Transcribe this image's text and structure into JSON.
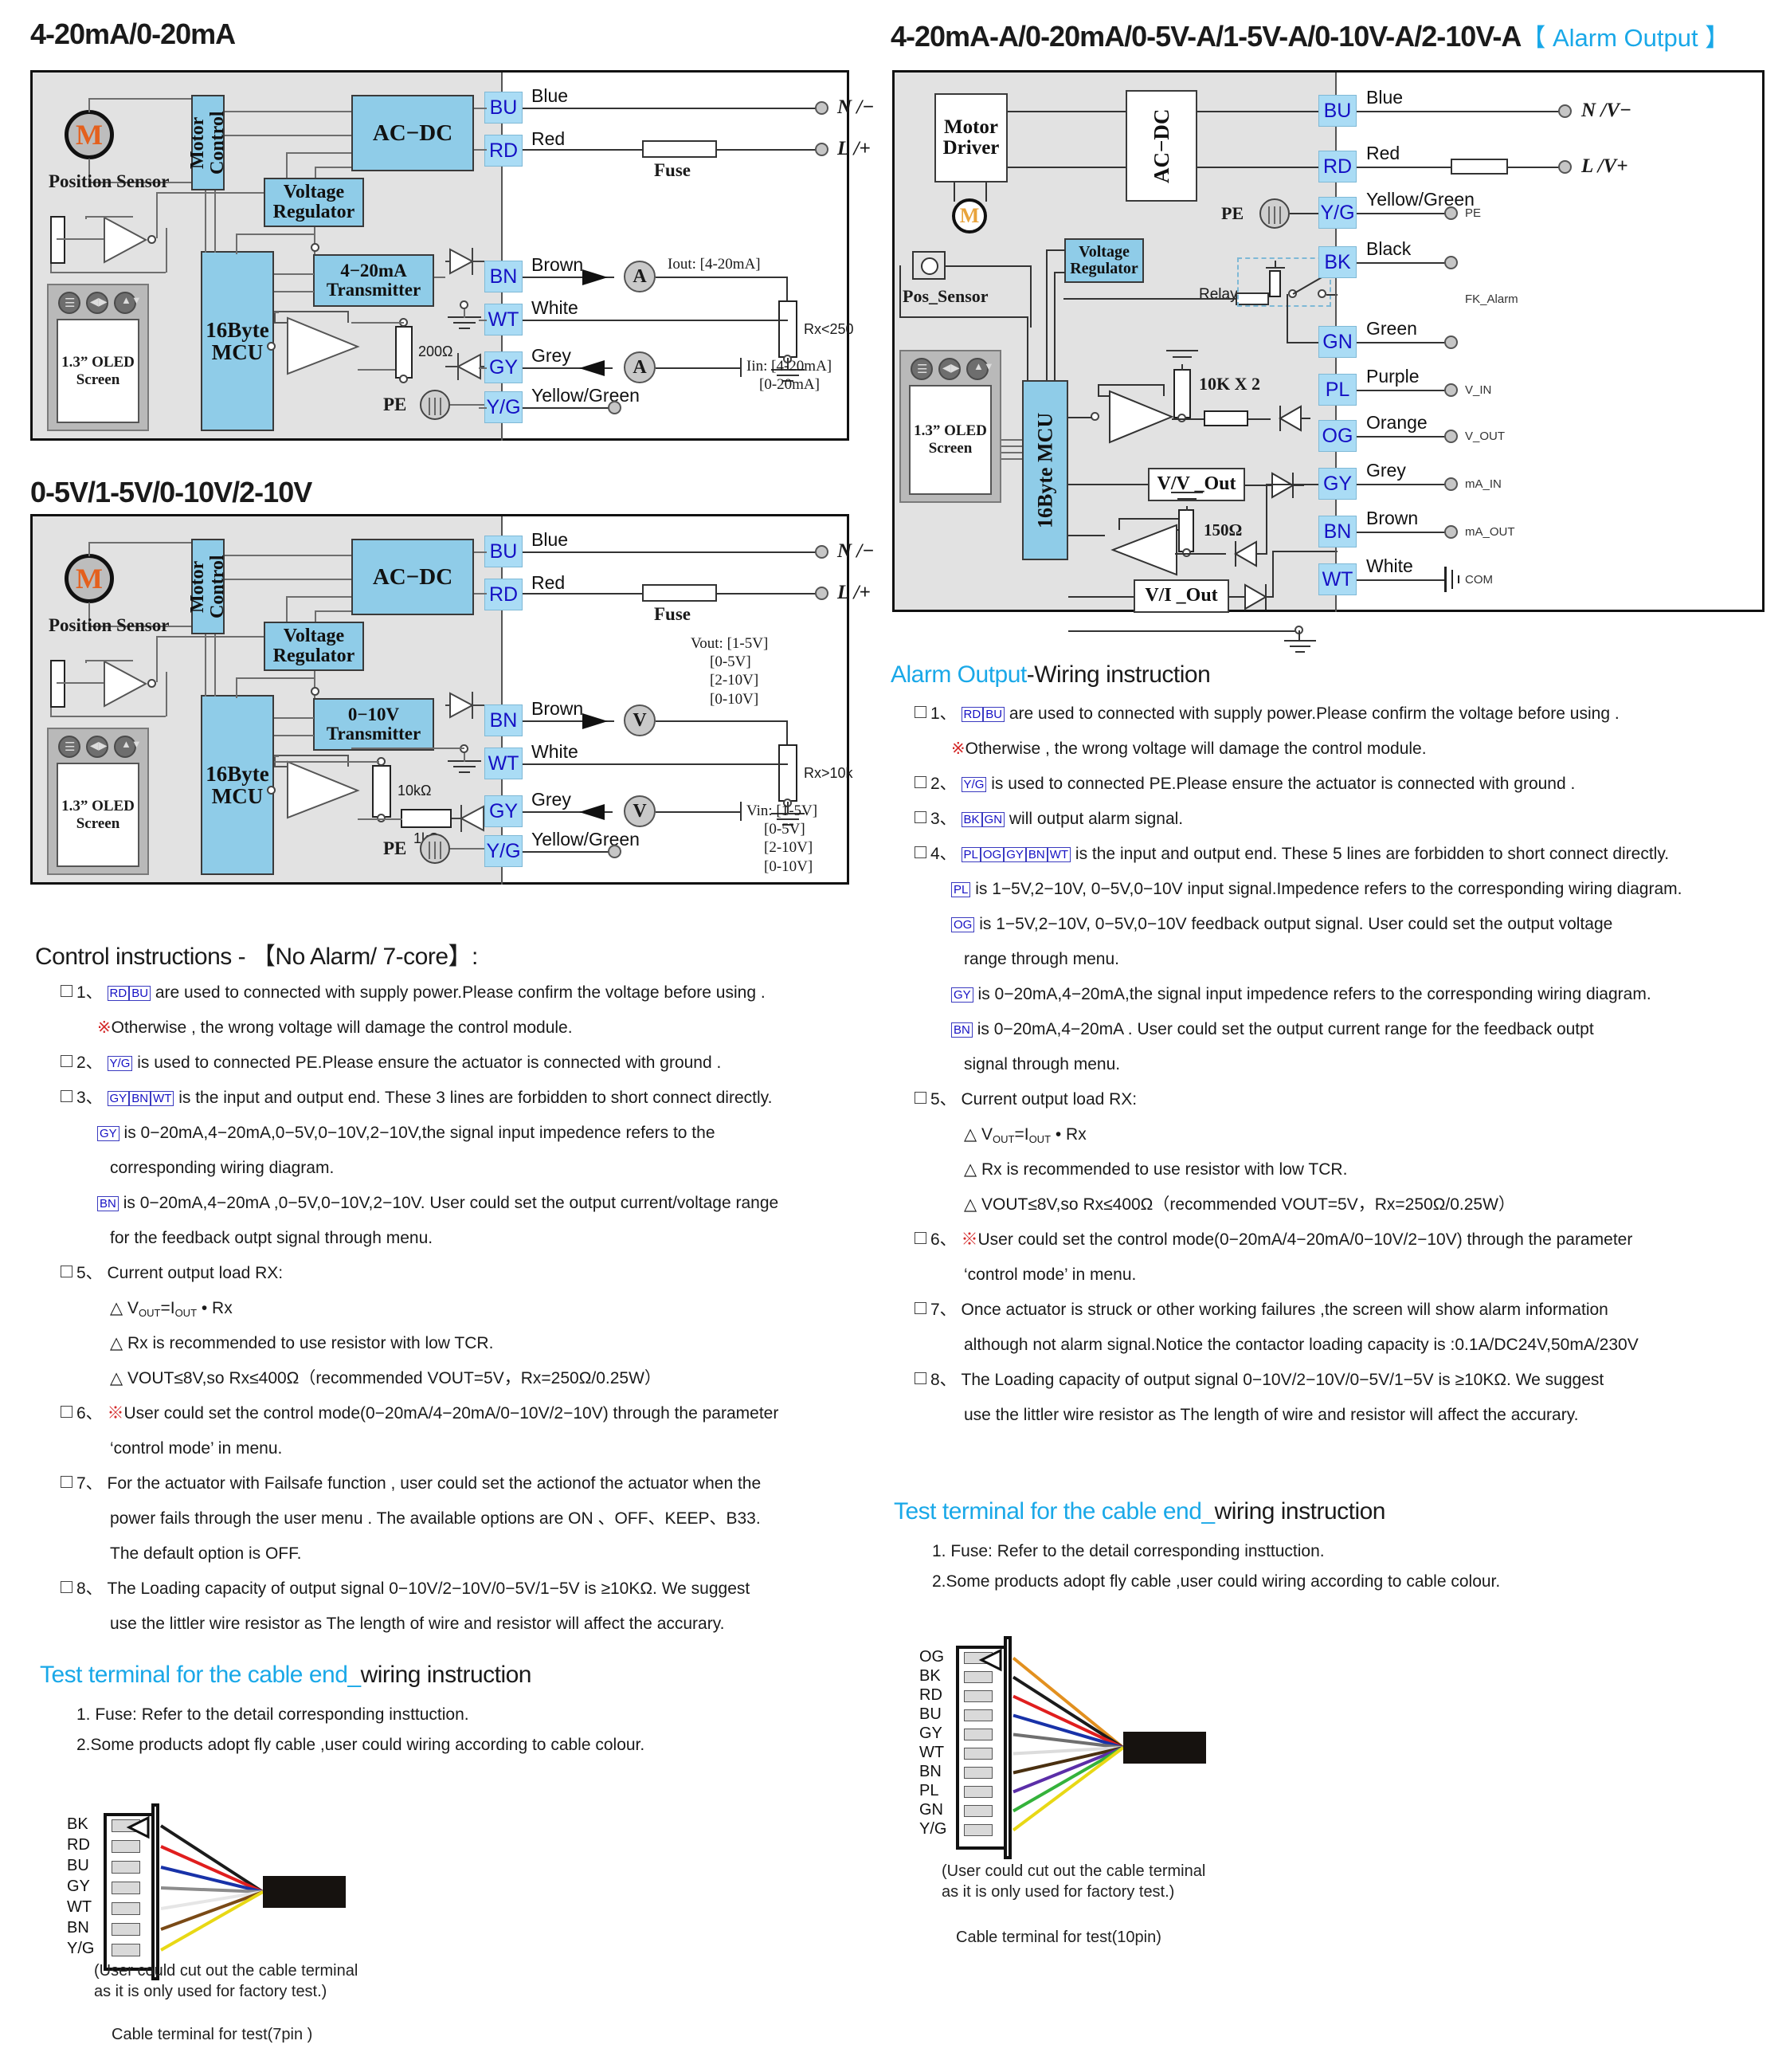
{
  "sections": {
    "diagram1_title": "4-20mA/0-20mA",
    "diagram2_title": "0-5V/1-5V/0-10V/2-10V",
    "diagram3_title": "4-20mA-A/0-20mA/0-5V-A/1-5V-A/0-10V-A/2-10V-A",
    "diagram3_tag": "【 Alarm Output 】",
    "control_head": "Control instructions - 【No Alarm/ 7-core】:",
    "alarm_head_blue": "Alarm Output",
    "alarm_head_rest": "-Wiring instruction",
    "test_head_blue": "Test terminal for the cable end_",
    "test_head_rest": "wiring instruction"
  },
  "blocks": {
    "motor_control": "Motor Control",
    "motor_driver": "Motor Driver",
    "ac_dc": "AC−DC",
    "voltage_regulator": "Voltage Regulator",
    "transmitter_ma": "4−20mA Transmitter",
    "transmitter_v": "0−10V Transmitter",
    "mcu": "16Byte MCU",
    "oled": "1.3” OLED Screen",
    "position_sensor": "Position Sensor",
    "pos_sensor_short": "Pos_Sensor",
    "motor_letter": "M",
    "pe": "PE",
    "relay": "Relay",
    "vv_out": "V/V _Out",
    "vi_out": "V/I _Out",
    "fuse": "Fuse"
  },
  "resistors": {
    "r200": "200Ω",
    "r10k": "10kΩ",
    "r1k": "1kΩ",
    "r150": "150Ω",
    "r10kx2": "10K X 2",
    "rx_lt250": "Rx<250",
    "rx_gt10k": "Rx>10k"
  },
  "diagram1": {
    "terminals": [
      {
        "code": "BU",
        "colour": "Blue",
        "end": "N /−"
      },
      {
        "code": "RD",
        "colour": "Red",
        "end": "L /+"
      },
      {
        "code": "BN",
        "colour": "Brown",
        "end": ""
      },
      {
        "code": "WT",
        "colour": "White",
        "end": ""
      },
      {
        "code": "GY",
        "colour": "Grey",
        "end": ""
      },
      {
        "code": "Y/G",
        "colour": "Yellow/Green",
        "end": ""
      }
    ],
    "meter_out_glyph": "A",
    "meter_in_glyph": "A",
    "iout_label": "Iout: [4-20mA]",
    "iin_label_1": "Iin: [4-20mA]",
    "iin_label_2": "[0-20mA]"
  },
  "diagram2": {
    "terminals": [
      {
        "code": "BU",
        "colour": "Blue",
        "end": "N /−"
      },
      {
        "code": "RD",
        "colour": "Red",
        "end": "L /+"
      },
      {
        "code": "BN",
        "colour": "Brown",
        "end": ""
      },
      {
        "code": "WT",
        "colour": "White",
        "end": ""
      },
      {
        "code": "GY",
        "colour": "Grey",
        "end": ""
      },
      {
        "code": "Y/G",
        "colour": "Yellow/Green",
        "end": ""
      }
    ],
    "meter_out_glyph": "V",
    "meter_in_glyph": "V",
    "vout_lines": [
      "Vout: [1-5V]",
      "[0-5V]",
      "[2-10V]",
      "[0-10V]"
    ],
    "vin_lines": [
      "Vin: [1-5V]",
      "[0-5V]",
      "[2-10V]",
      "[0-10V]"
    ]
  },
  "diagram3": {
    "terminals": [
      {
        "code": "BU",
        "colour": "Blue",
        "end": "N /V−",
        "fn": ""
      },
      {
        "code": "RD",
        "colour": "Red",
        "end": "L /V+",
        "fn": ""
      },
      {
        "code": "Y/G",
        "colour": "Yellow/Green",
        "end": "",
        "fn": "PE"
      },
      {
        "code": "BK",
        "colour": "Black",
        "end": "",
        "fn": ""
      },
      {
        "code": "GN",
        "colour": "Green",
        "end": "",
        "fn": ""
      },
      {
        "code": "PL",
        "colour": "Purple",
        "end": "",
        "fn": "V_IN"
      },
      {
        "code": "OG",
        "colour": "Orange",
        "end": "",
        "fn": "V_OUT"
      },
      {
        "code": "GY",
        "colour": "Grey",
        "end": "",
        "fn": "mA_IN"
      },
      {
        "code": "BN",
        "colour": "Brown",
        "end": "",
        "fn": "mA_OUT"
      },
      {
        "code": "WT",
        "colour": "White",
        "end": "",
        "fn": "COM"
      }
    ],
    "fk_alarm": "FK_Alarm"
  },
  "control_items": [
    {
      "n": "1、",
      "tags": [
        "RD",
        "BU"
      ],
      "text": "are used to connected with  supply power.Please confirm the voltage before using ."
    },
    {
      "n": "",
      "note": "※Otherwise , the wrong voltage will damage the control module."
    },
    {
      "n": "2、",
      "tags": [
        "Y/G"
      ],
      "text": "is used to connected PE.Please  ensure the actuator is connected with ground ."
    },
    {
      "n": "3、",
      "tags": [
        "GY",
        "BN",
        "WT"
      ],
      "text": "is the input and output end. These 3 lines are forbidden to short connect directly."
    },
    {
      "n": "",
      "tags": [
        "GY"
      ],
      "text": "is 0−20mA,4−20mA,0−5V,0−10V,2−10V,the signal input impedence refers to the"
    },
    {
      "n": "",
      "cont": "corresponding wiring diagram."
    },
    {
      "n": "",
      "tags": [
        "BN"
      ],
      "text": "is 0−20mA,4−20mA ,0−5V,0−10V,2−10V. User could set the output current/voltage range"
    },
    {
      "n": "",
      "cont": "for the feedback outpt signal through menu."
    },
    {
      "n": "5、",
      "text": "Current output  load RX:"
    },
    {
      "n": "",
      "cont": "△ VOUT=IOUT • Rx"
    },
    {
      "n": "",
      "cont": "△ Rx is recommended to use resistor with low TCR."
    },
    {
      "n": "",
      "cont": "△ VOUT≤8V,so Rx≤400Ω（recommended VOUT=5V，Rx=250Ω/0.25W）"
    },
    {
      "n": "6、",
      "text": "※User could set the control mode(0−20mA/4−20mA/0−10V/2−10V)  through the  parameter"
    },
    {
      "n": "",
      "cont": "‘control mode’ in menu."
    },
    {
      "n": "7、",
      "text": "For the actuator with Failsafe function , user could set the actionof the actuator when the"
    },
    {
      "n": "",
      "cont": "power fails through the  user menu . The available options are  ON 、OFF、KEEP、B33."
    },
    {
      "n": "",
      "cont": "The default option is OFF."
    },
    {
      "n": "8、",
      "text": "The Loading capacity  of output signal  0−10V/2−10V/0−5V/1−5V is  ≥10KΩ. We suggest"
    },
    {
      "n": "",
      "cont": "use the littler wire resistor as The length of wire and resistor will affect the accurary."
    }
  ],
  "alarm_items": [
    {
      "n": "1、",
      "tags": [
        "RD",
        "BU"
      ],
      "text": "are used to connected with  supply power.Please confirm the voltage before using ."
    },
    {
      "n": "",
      "note": "※Otherwise , the wrong voltage will damage the control module."
    },
    {
      "n": "2、",
      "tags": [
        "Y/G"
      ],
      "text": "is used to connected PE.Please  ensure the actuator is connected with ground ."
    },
    {
      "n": "3、",
      "tags": [
        "BK",
        "GN"
      ],
      "text": "will output alarm signal."
    },
    {
      "n": "4、",
      "tags": [
        "PL",
        "OG",
        "GY",
        "BN",
        "WT"
      ],
      "text": "is the input and output end. These 5 lines are forbidden to short connect directly."
    },
    {
      "n": "",
      "tags": [
        "PL"
      ],
      "text": "is 1−5V,2−10V, 0−5V,0−10V input signal.Impedence refers to the corresponding wiring diagram."
    },
    {
      "n": "",
      "tags": [
        "OG"
      ],
      "text": "is 1−5V,2−10V, 0−5V,0−10V feedback output signal. User could set the output voltage"
    },
    {
      "n": "",
      "cont": "range through menu."
    },
    {
      "n": "",
      "tags": [
        "GY"
      ],
      "text": "is 0−20mA,4−20mA,the signal input impedence refers to the corresponding wiring diagram."
    },
    {
      "n": "",
      "tags": [
        "BN"
      ],
      "text": "is 0−20mA,4−20mA . User could set the output current range for the feedback outpt"
    },
    {
      "n": "",
      "cont": "signal through menu."
    },
    {
      "n": "5、",
      "text": "Current output  load RX:"
    },
    {
      "n": "",
      "cont": "△ VOUT=IOUT • Rx"
    },
    {
      "n": "",
      "cont": "△ Rx is recommended to use resistor with low TCR."
    },
    {
      "n": "",
      "cont": "△ VOUT≤8V,so Rx≤400Ω（recommended VOUT=5V，Rx=250Ω/0.25W）"
    },
    {
      "n": "6、",
      "text": "※User could set the control mode(0−20mA/4−20mA/0−10V/2−10V)  through the  parameter"
    },
    {
      "n": "",
      "cont": "‘control mode’ in menu."
    },
    {
      "n": "7、",
      "text": "Once actuator is struck or other working failures ,the screen will show alarm information"
    },
    {
      "n": "",
      "cont": "although not alarm signal.Notice the contactor loading capacity is :0.1A/DC24V,50mA/230V"
    },
    {
      "n": "8、",
      "text": "The Loading capacity  of output signal  0−10V/2−10V/0−5V/1−5V is  ≥10KΩ. We suggest"
    },
    {
      "n": "",
      "cont": "use the littler wire resistor as The length of wire and resistor will affect the accurary."
    }
  ],
  "test_terminal": {
    "line1": "1. Fuse: Refer to the detail corresponding insttuction.",
    "line2": "2.Some products adopt fly cable ,user could wiring according to cable colour.",
    "note_l1": "(User could cut out the cable terminal",
    "note_l2": "as it is only used for factory test.)",
    "caption_7pin": "Cable terminal for test(7pin )",
    "caption_10pin": "Cable terminal for test(10pin)",
    "pins_7": [
      {
        "code": "BK",
        "colour": "#1b1b1b"
      },
      {
        "code": "RD",
        "colour": "#e01e1e"
      },
      {
        "code": "BU",
        "colour": "#1832a8"
      },
      {
        "code": "GY",
        "colour": "#8c8c8c"
      },
      {
        "code": "WT",
        "colour": "#e6e6e6"
      },
      {
        "code": "BN",
        "colour": "#7a4a16"
      },
      {
        "code": "Y/G",
        "colour": "#e8d815"
      }
    ],
    "pins_10": [
      {
        "code": "OG",
        "colour": "#e2901f"
      },
      {
        "code": "BK",
        "colour": "#1b1b1b"
      },
      {
        "code": "RD",
        "colour": "#e01e1e"
      },
      {
        "code": "BU",
        "colour": "#1832a8"
      },
      {
        "code": "GY",
        "colour": "#6f6f6f"
      },
      {
        "code": "WT",
        "colour": "#dcdcdc"
      },
      {
        "code": "BN",
        "colour": "#4a3010"
      },
      {
        "code": "PL",
        "colour": "#5b2ea8"
      },
      {
        "code": "GN",
        "colour": "#35b23b"
      },
      {
        "code": "Y/G",
        "colour": "#e8d815"
      }
    ]
  },
  "colors": {
    "accent_blue": "#19a8e8",
    "block_fill": "#8fcce8",
    "terminal_fill": "#aadcf5",
    "terminal_text": "#1510c4",
    "panel_grey": "#e2e2e2",
    "motor_orange": "#e4601d"
  }
}
